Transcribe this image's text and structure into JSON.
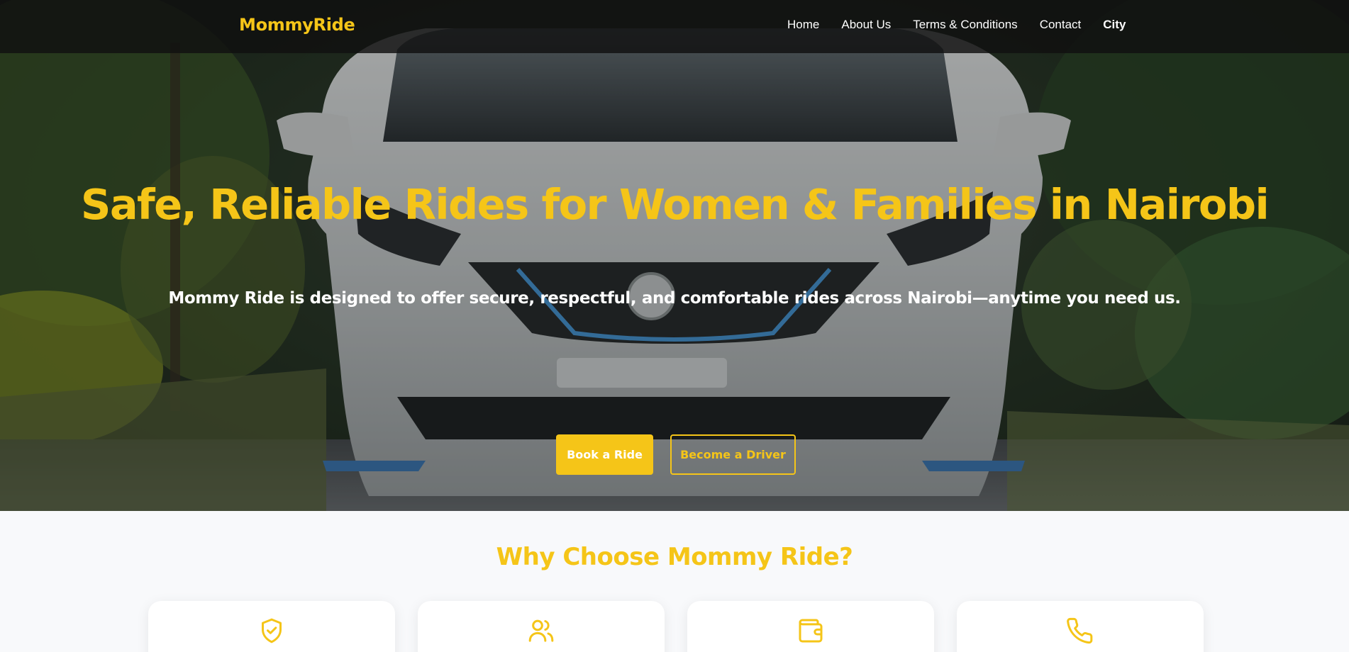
{
  "brand": {
    "name": "MommyRide",
    "color": "#f5c518"
  },
  "nav": {
    "items": [
      {
        "label": "Home"
      },
      {
        "label": "About Us"
      },
      {
        "label": "Terms & Conditions"
      },
      {
        "label": "Contact"
      },
      {
        "label": "City"
      }
    ]
  },
  "hero": {
    "title": "Safe, Reliable Rides for Women & Families in Nairobi",
    "subtitle": "Mommy Ride is designed to offer secure, respectful, and comfortable rides across Nairobi—anytime you need us.",
    "primary_button": "Book a Ride",
    "secondary_button": "Become a Driver",
    "background": "photo of a white car on a tree-lined road"
  },
  "features": {
    "title": "Why Choose Mommy Ride?",
    "cards": [
      {
        "icon": "shield-check-icon"
      },
      {
        "icon": "users-icon"
      },
      {
        "icon": "wallet-icon"
      },
      {
        "icon": "phone-icon"
      }
    ]
  },
  "colors": {
    "accent": "#f5c518",
    "navbar": "#101010",
    "section_bg": "#f8f9fb"
  }
}
